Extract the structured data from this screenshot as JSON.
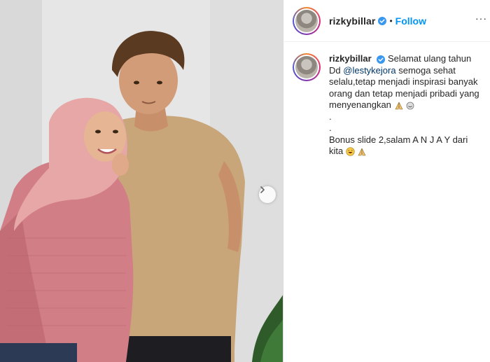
{
  "post": {
    "username": "rizkybillar",
    "follow_label": "Follow",
    "separator": "•",
    "more_label": "···"
  },
  "caption": {
    "username": "rizkybillar",
    "text_before": "Selamat ulang tahun Dd",
    "mention": "@lestykejora",
    "text_after": "semoga sehat selalu,tetap menjadi inspirasi banyak orang dan tetap menjadi pribadi yang menyenangkan",
    "dot1": ".",
    "dot2": ".",
    "bonus_text": "Bonus slide 2,salam A N J A Y dari kita"
  },
  "icons": {
    "verified": "verified-badge-icon",
    "next": "chevron-right-icon",
    "pray": "pray-emoji",
    "smile": "smile-emoji",
    "laugh": "laugh-emoji"
  },
  "colors": {
    "link": "#0095f6",
    "mention": "#00376b",
    "verified": "#3897f0"
  }
}
